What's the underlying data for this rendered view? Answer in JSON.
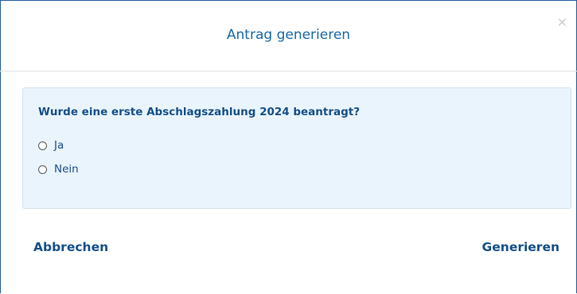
{
  "dialog": {
    "title": "Antrag generieren",
    "close_symbol": "×"
  },
  "question": {
    "text": "Wurde eine erste Abschlagszahlung 2024 beantragt?",
    "options": [
      {
        "label": "Ja",
        "selected": false
      },
      {
        "label": "Nein",
        "selected": false
      }
    ]
  },
  "footer": {
    "cancel_label": "Abbrechen",
    "generate_label": "Generieren"
  },
  "colors": {
    "accent": "#14508a",
    "panel_background": "#eaf4fc",
    "border": "#1f5c99"
  },
  "icons": {
    "close": "close-icon",
    "radio": "radio-unchecked-icon"
  }
}
